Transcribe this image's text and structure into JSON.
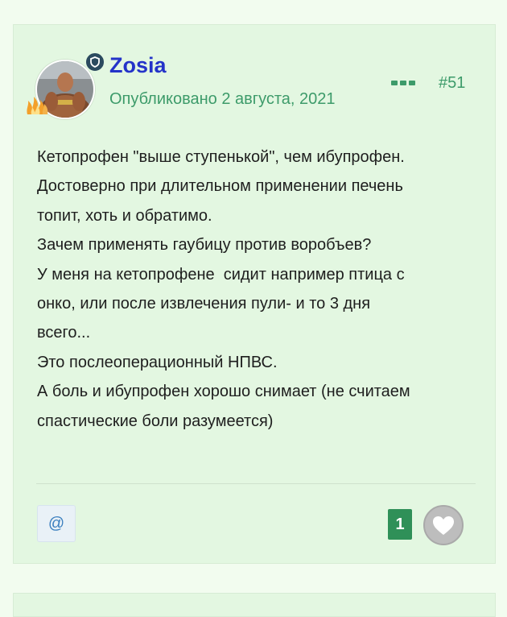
{
  "post": {
    "author": "Zosia",
    "published": "Опубликовано 2 августа, 2021",
    "post_number": "#51",
    "body_lines": [
      "Кетопрофен \"выше ступенькой\", чем ибупрофен.",
      "Достоверно при длительном применении печень",
      "топит, хоть и обратимо.",
      "Зачем применять гаубицу против воробъев?",
      "У меня на кетопрофене  сидит например птица с",
      "онко, или после извлечения пули- и то 3 дня",
      "всего...",
      "Это послеоперационный НПВС.",
      "А боль и ибупрофен хорошо снимает (не считаем",
      "спастические боли разумеется)"
    ]
  },
  "footer": {
    "mention_label": "@",
    "like_count": "1"
  },
  "icons": {
    "role_badge": "shield-icon",
    "more_menu": "more-options-icon",
    "like": "heart-icon",
    "flame": "flame-icon"
  },
  "colors": {
    "page_background": "#f2fcef",
    "card_background": "#e3f7e1",
    "username": "#2433c9",
    "meta_text": "#3d9b6a",
    "like_count_bg": "#2f9058",
    "badge_bg": "#2b4a5f"
  }
}
